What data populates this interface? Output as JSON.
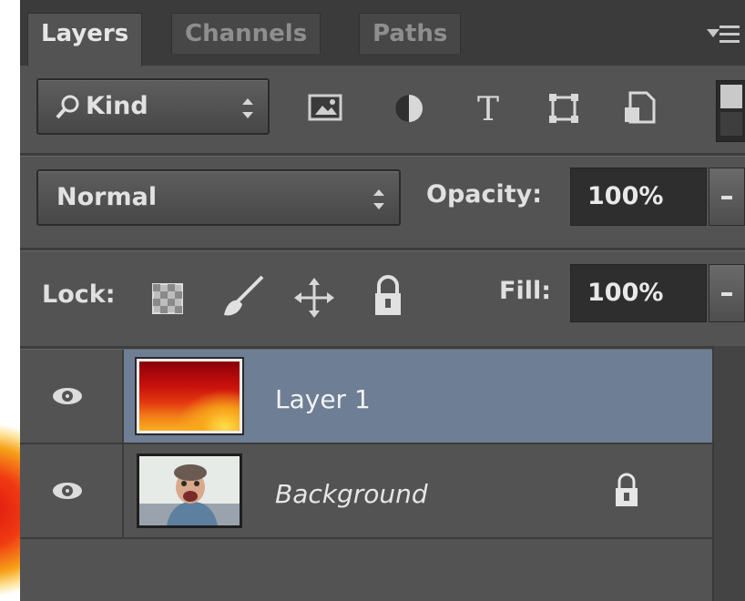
{
  "tabs": [
    {
      "label": "Layers",
      "active": true
    },
    {
      "label": "Channels",
      "active": false
    },
    {
      "label": "Paths",
      "active": false
    }
  ],
  "filter": {
    "kind_label": "Kind",
    "icons": [
      "image-filter-icon",
      "adjustment-filter-icon",
      "type-filter-icon",
      "shape-filter-icon",
      "smart-object-filter-icon",
      "filter-toggle-icon"
    ]
  },
  "blend": {
    "mode": "Normal"
  },
  "opacity": {
    "label": "Opacity:",
    "value": "100%"
  },
  "lock": {
    "label": "Lock:",
    "icons": [
      "lock-transparent-pixels-icon",
      "lock-image-pixels-icon",
      "lock-position-icon",
      "lock-all-icon"
    ]
  },
  "fill": {
    "label": "Fill:",
    "value": "100%"
  },
  "layers": [
    {
      "name": "Layer 1",
      "selected": true,
      "visible": true,
      "locked": false
    },
    {
      "name": "Background",
      "selected": false,
      "visible": true,
      "locked": true
    }
  ],
  "colors": {
    "selected_row": "#6e7e94",
    "panel": "#535353"
  }
}
